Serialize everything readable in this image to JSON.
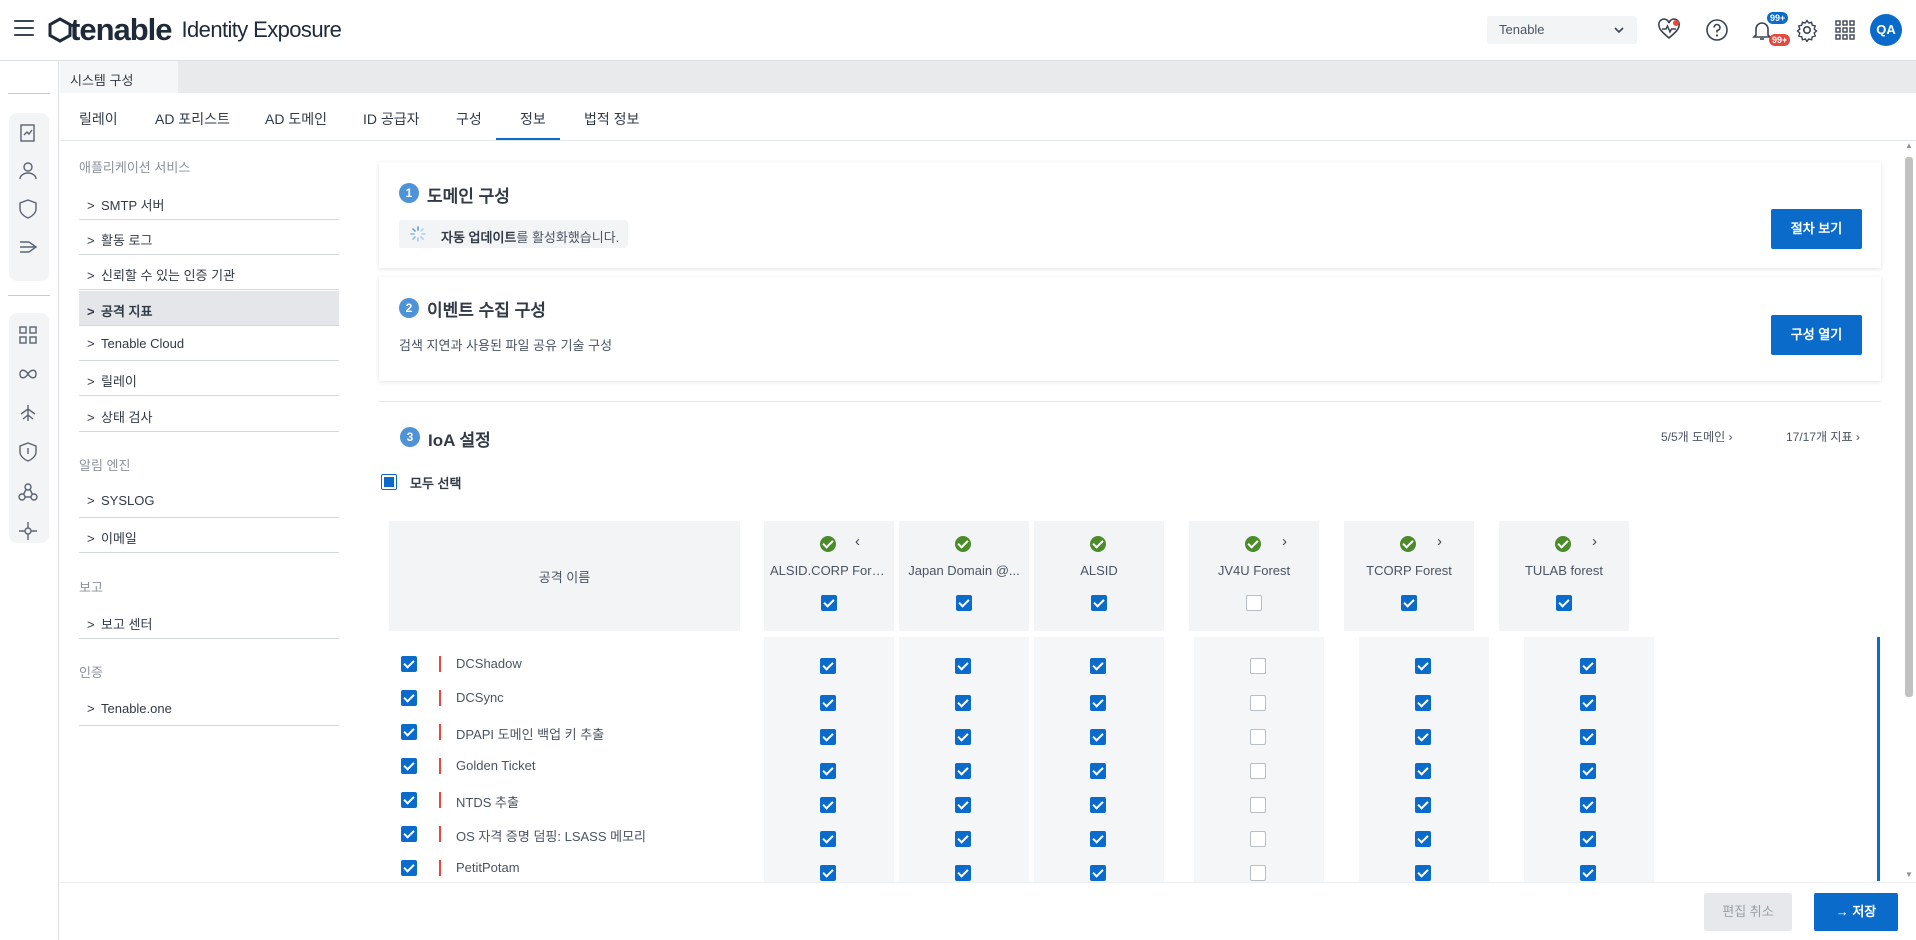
{
  "header": {
    "logo_word": "tenable",
    "logo_sub": "Identity Exposure",
    "tenant": "Tenable",
    "notif_badge_1": "99+",
    "notif_badge_2": "99+",
    "avatar": "QA",
    "icons": [
      "menu-icon",
      "health-icon",
      "help-icon",
      "bell-icon",
      "gear-icon",
      "apps-grid-icon"
    ]
  },
  "breadcrumb": {
    "tab": "시스템 구성"
  },
  "tabs": [
    "릴레이",
    "AD 포리스트",
    "AD 도메인",
    "ID 공급자",
    "구성",
    "정보",
    "법적 정보"
  ],
  "active_tab": "구성",
  "sidebar": {
    "sections": [
      {
        "title": "애플리케이션 서비스",
        "items": [
          "SMTP 서버",
          "활동 로그",
          "신뢰할 수 있는 인증 기관",
          "공격 지표",
          "Tenable Cloud",
          "릴레이",
          "상태 검사"
        ]
      },
      {
        "title": "알림 엔진",
        "items": [
          "SYSLOG",
          "이메일"
        ]
      },
      {
        "title": "보고",
        "items": [
          "보고 센터"
        ]
      },
      {
        "title": "인증",
        "items": [
          "Tenable.one"
        ]
      }
    ],
    "selected": "공격 지표"
  },
  "step1": {
    "num": "1",
    "title": "도메인 구성",
    "notice_bold": "자동 업데이트",
    "notice_rest": "를 활성화했습니다.",
    "button": "절차 보기"
  },
  "step2": {
    "num": "2",
    "title": "이벤트 수집 구성",
    "desc": "검색 지연과 사용된 파일 공유 기술 구성",
    "button": "구성 열기"
  },
  "step3": {
    "num": "3",
    "title": "IoA 설정",
    "domains_link": "5/5개 도메인",
    "indicators_link": "17/17개 지표",
    "select_all": "모두 선택",
    "attack_name_header": "공격 이름"
  },
  "domains": [
    {
      "name": "ALSID.CORP Fore...",
      "enabled": true,
      "status": "ok"
    },
    {
      "name": "Japan Domain @...",
      "enabled": true,
      "status": "ok"
    },
    {
      "name": "ALSID",
      "enabled": true,
      "status": "ok"
    },
    {
      "name": "JV4U Forest",
      "enabled": false,
      "status": "ok"
    },
    {
      "name": "TCORP Forest",
      "enabled": true,
      "status": "ok"
    },
    {
      "name": "TULAB forest",
      "enabled": true,
      "status": "ok"
    }
  ],
  "attacks": [
    "DCShadow",
    "DCSync",
    "DPAPI 도메인 백업 키 추출",
    "Golden Ticket",
    "NTDS 추출",
    "OS 자격 증명 덤핑: LSASS 메모리",
    "PetitPotam"
  ],
  "footer": {
    "cancel": "편집 취소",
    "save": "저장"
  },
  "colors": {
    "accent": "#0b6bcb",
    "ok": "#4c8b2b",
    "danger": "#e5483f"
  }
}
